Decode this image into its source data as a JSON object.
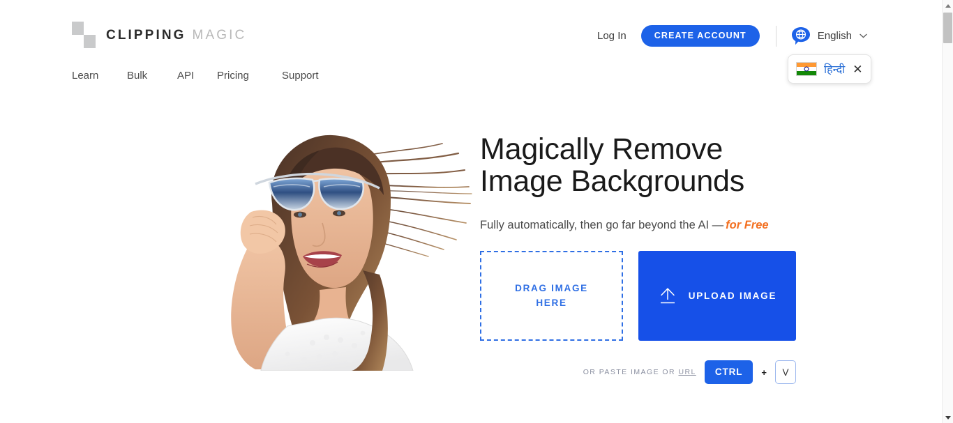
{
  "brand": {
    "name_bold": "CLIPPING",
    "name_light": "MAGIC",
    "logo_icon": "checkerboard-icon"
  },
  "nav": {
    "items": [
      {
        "label": "Learn"
      },
      {
        "label": "Bulk"
      },
      {
        "label": "API"
      },
      {
        "label": "Pricing"
      },
      {
        "label": "Support"
      }
    ]
  },
  "header_right": {
    "login_label": "Log In",
    "create_account_label": "CREATE ACCOUNT",
    "language_label": "English",
    "language_icon": "globe-speech-bubble-icon",
    "chevron": "⌄"
  },
  "lang_popup": {
    "flag_icon": "india-flag-icon",
    "language_label": "हिन्दी",
    "close_label": "✕"
  },
  "hero": {
    "title": "Magically Remove\nImage Backgrounds",
    "subtitle_plain": "Fully automatically, then go far beyond the AI —",
    "subtitle_accent": "for Free",
    "photo_alt": "woman-with-sunglasses-photo"
  },
  "cta": {
    "drag_label": "DRAG IMAGE HERE",
    "upload_label": "UPLOAD IMAGE",
    "upload_icon": "upload-arrow-icon"
  },
  "paste": {
    "prefix": "OR PASTE IMAGE OR ",
    "url_label": "URL",
    "key_ctrl": "CTRL",
    "plus": "+",
    "key_v": "V"
  },
  "scrollbar": {
    "up_label": "scroll-up",
    "down_label": "scroll-down"
  },
  "colors": {
    "primary_blue": "#1d62e8",
    "upload_blue": "#1650e8",
    "accent_orange": "#f37021",
    "drag_border_blue": "#2f6fe4",
    "hindi_blue": "#2a6fd6",
    "logo_gray": "#c9cacb"
  }
}
